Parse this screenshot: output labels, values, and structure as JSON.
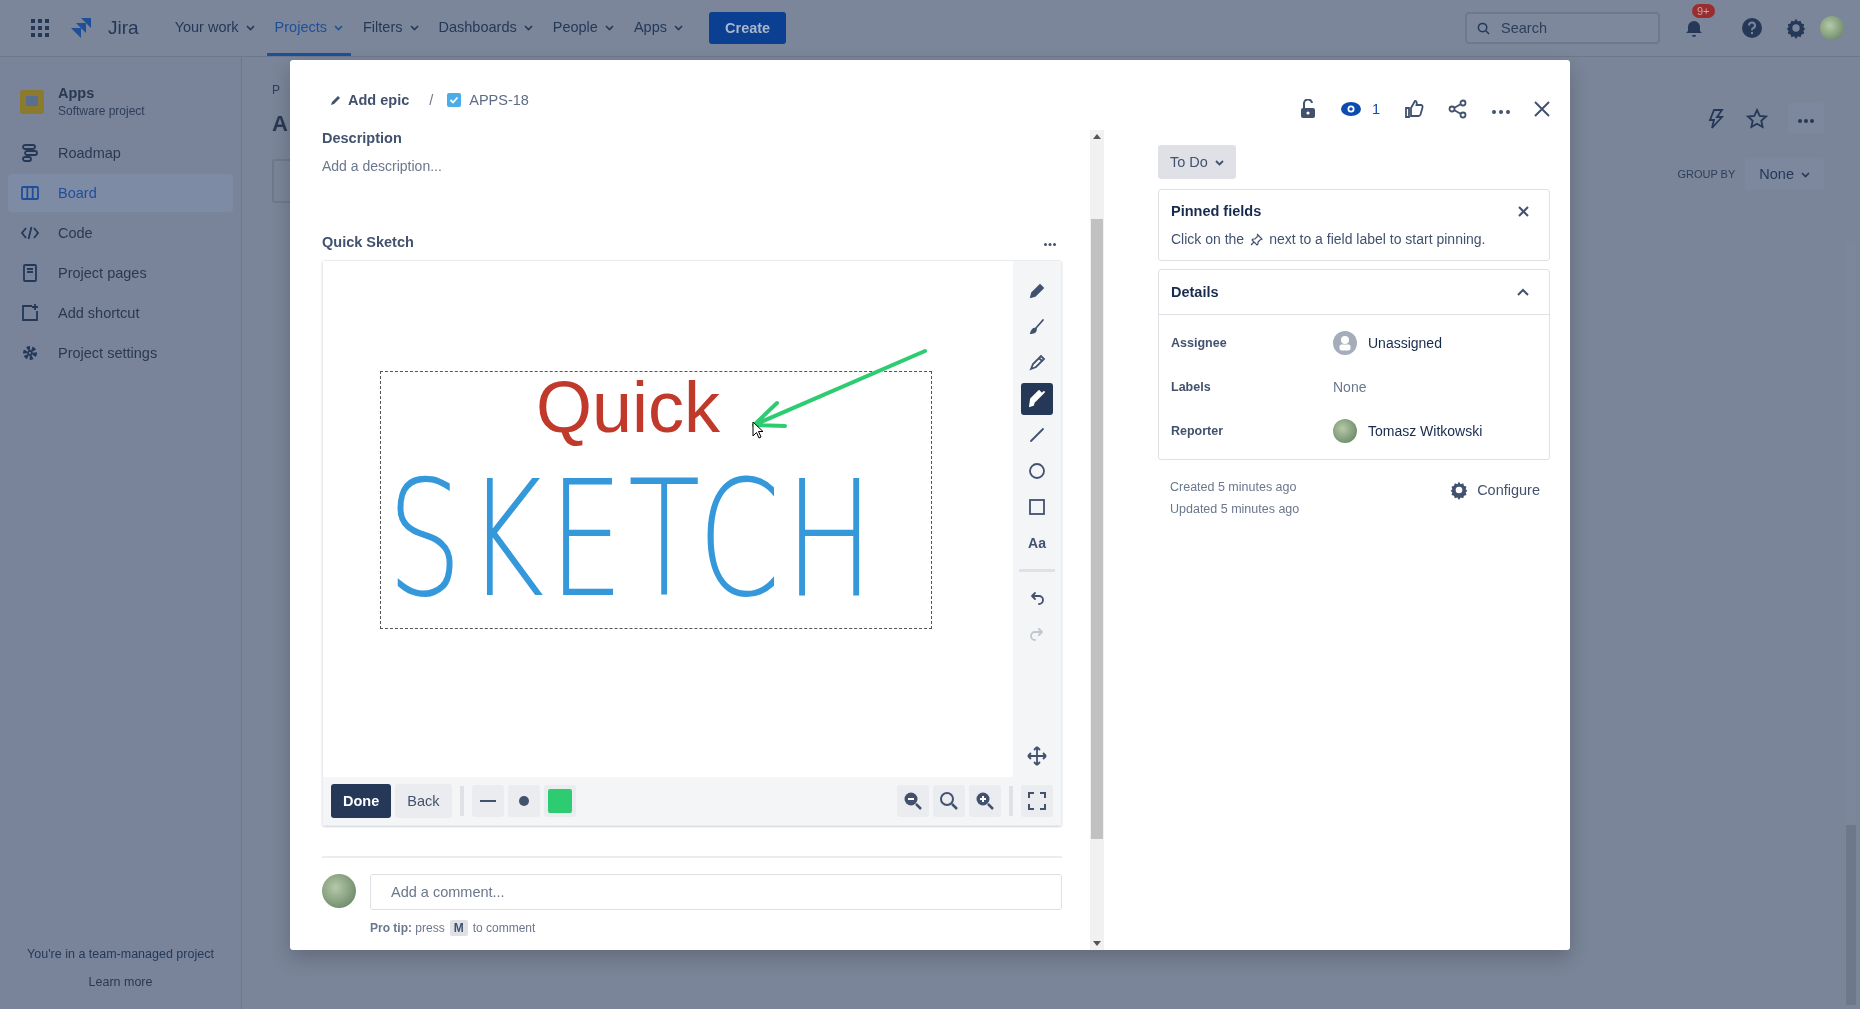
{
  "topbar": {
    "logo": "Jira",
    "menus": [
      {
        "label": "Your work",
        "selected": false
      },
      {
        "label": "Projects",
        "selected": true
      },
      {
        "label": "Filters",
        "selected": false
      },
      {
        "label": "Dashboards",
        "selected": false
      },
      {
        "label": "People",
        "selected": false
      },
      {
        "label": "Apps",
        "selected": false
      }
    ],
    "create": "Create",
    "search_placeholder": "Search",
    "notification_badge": "9+"
  },
  "sidebar": {
    "project": {
      "name": "Apps",
      "type": "Software project"
    },
    "items": [
      {
        "label": "Roadmap",
        "kind": "roadmap",
        "selected": false
      },
      {
        "label": "Board",
        "kind": "board",
        "selected": true
      },
      {
        "label": "Code",
        "kind": "code",
        "selected": false
      },
      {
        "label": "Project pages",
        "kind": "pages",
        "selected": false
      },
      {
        "label": "Add shortcut",
        "kind": "shortcut",
        "selected": false
      },
      {
        "label": "Project settings",
        "kind": "settings",
        "selected": false
      }
    ],
    "footer": {
      "note": "You're in a team-managed project",
      "link": "Learn more"
    }
  },
  "board": {
    "breadcrumb": "P",
    "heading": "A",
    "group_by": {
      "label": "GROUP BY",
      "value": "None"
    }
  },
  "issue": {
    "epic": "Add epic",
    "separator": "/",
    "key": "APPS-18",
    "watchers": "1",
    "description": {
      "label": "Description",
      "placeholder": "Add a description..."
    },
    "sketch": {
      "title": "Quick Sketch",
      "text": "Quick",
      "handwriting": "SKETCH",
      "tools": [
        {
          "kind": "pencil",
          "selected": false,
          "disabled": false
        },
        {
          "kind": "brush",
          "selected": false,
          "disabled": false
        },
        {
          "kind": "dropper",
          "selected": false,
          "disabled": false
        },
        {
          "kind": "marker",
          "selected": true,
          "disabled": false
        },
        {
          "kind": "line",
          "selected": false,
          "disabled": false
        },
        {
          "kind": "ellipse",
          "selected": false,
          "disabled": false
        },
        {
          "kind": "rect",
          "selected": false,
          "disabled": false
        },
        {
          "kind": "text",
          "label": "Aa",
          "selected": false,
          "disabled": false
        },
        {
          "kind": "undo",
          "selected": false,
          "disabled": false
        },
        {
          "kind": "redo",
          "selected": false,
          "disabled": true
        }
      ],
      "done": "Done",
      "back": "Back",
      "color": "#2ecc71"
    },
    "comment": {
      "placeholder": "Add a comment...",
      "tip": "**Pro tip:** press",
      "key": "M",
      "tip_end": "to comment"
    },
    "status": "To Do",
    "pinned": {
      "title": "Pinned fields",
      "text_before": "Click on the",
      "text_after": "next to a field label to start pinning."
    },
    "details": {
      "title": "Details",
      "expanded": true,
      "fields": [
        {
          "label": "Assignee",
          "value": "Unassigned",
          "kind": "empty-user"
        },
        {
          "label": "Labels",
          "value": "None",
          "kind": "text"
        },
        {
          "label": "Reporter",
          "value": "Tomasz Witkowski",
          "kind": "user"
        }
      ]
    },
    "created": "Created 5 minutes ago",
    "updated": "Updated 5 minutes ago",
    "configure": "Configure"
  }
}
